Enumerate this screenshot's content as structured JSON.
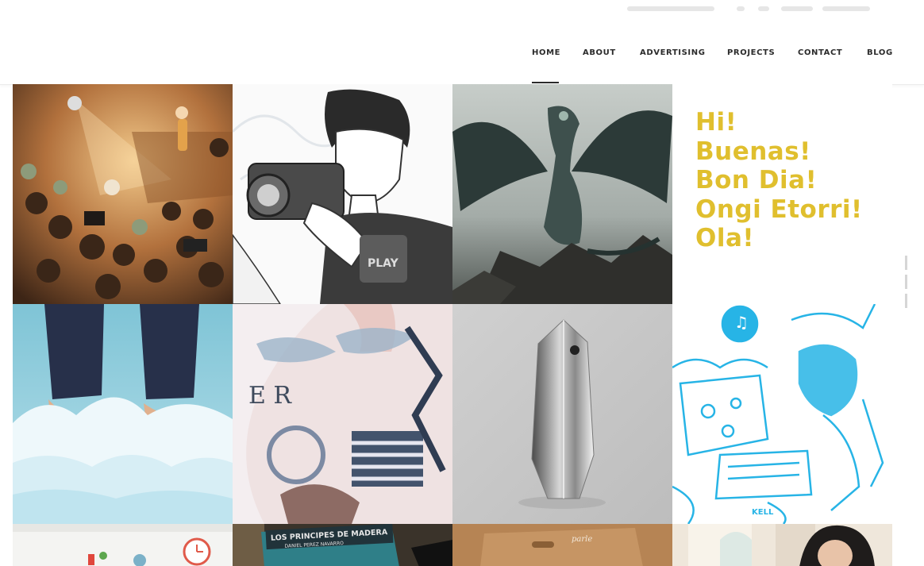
{
  "nav": {
    "items": [
      {
        "label": "HOME"
      },
      {
        "label": "ABOUT"
      },
      {
        "label": "ADVERTISING"
      },
      {
        "label": "PROJECTS"
      },
      {
        "label": "CONTACT"
      },
      {
        "label": "BLOG"
      }
    ],
    "active": "HOME"
  },
  "greeting": {
    "lines": [
      "Hi!",
      "Buenas!",
      "Bon Dia!",
      "Ongi Etorri!",
      "Ola!"
    ],
    "color": "#e0bf2e"
  },
  "tiles": {
    "tattoo_text": "E R",
    "book_title": "LOS PRINCIPES DE MADERA",
    "book_author": "DANIEL PEREZ NAVARRO"
  },
  "colors": {
    "nav_text": "#2b2b2b",
    "background": "#ffffff",
    "accent_yellow": "#e0bf2e",
    "cyan_line": "#27b4e6"
  }
}
